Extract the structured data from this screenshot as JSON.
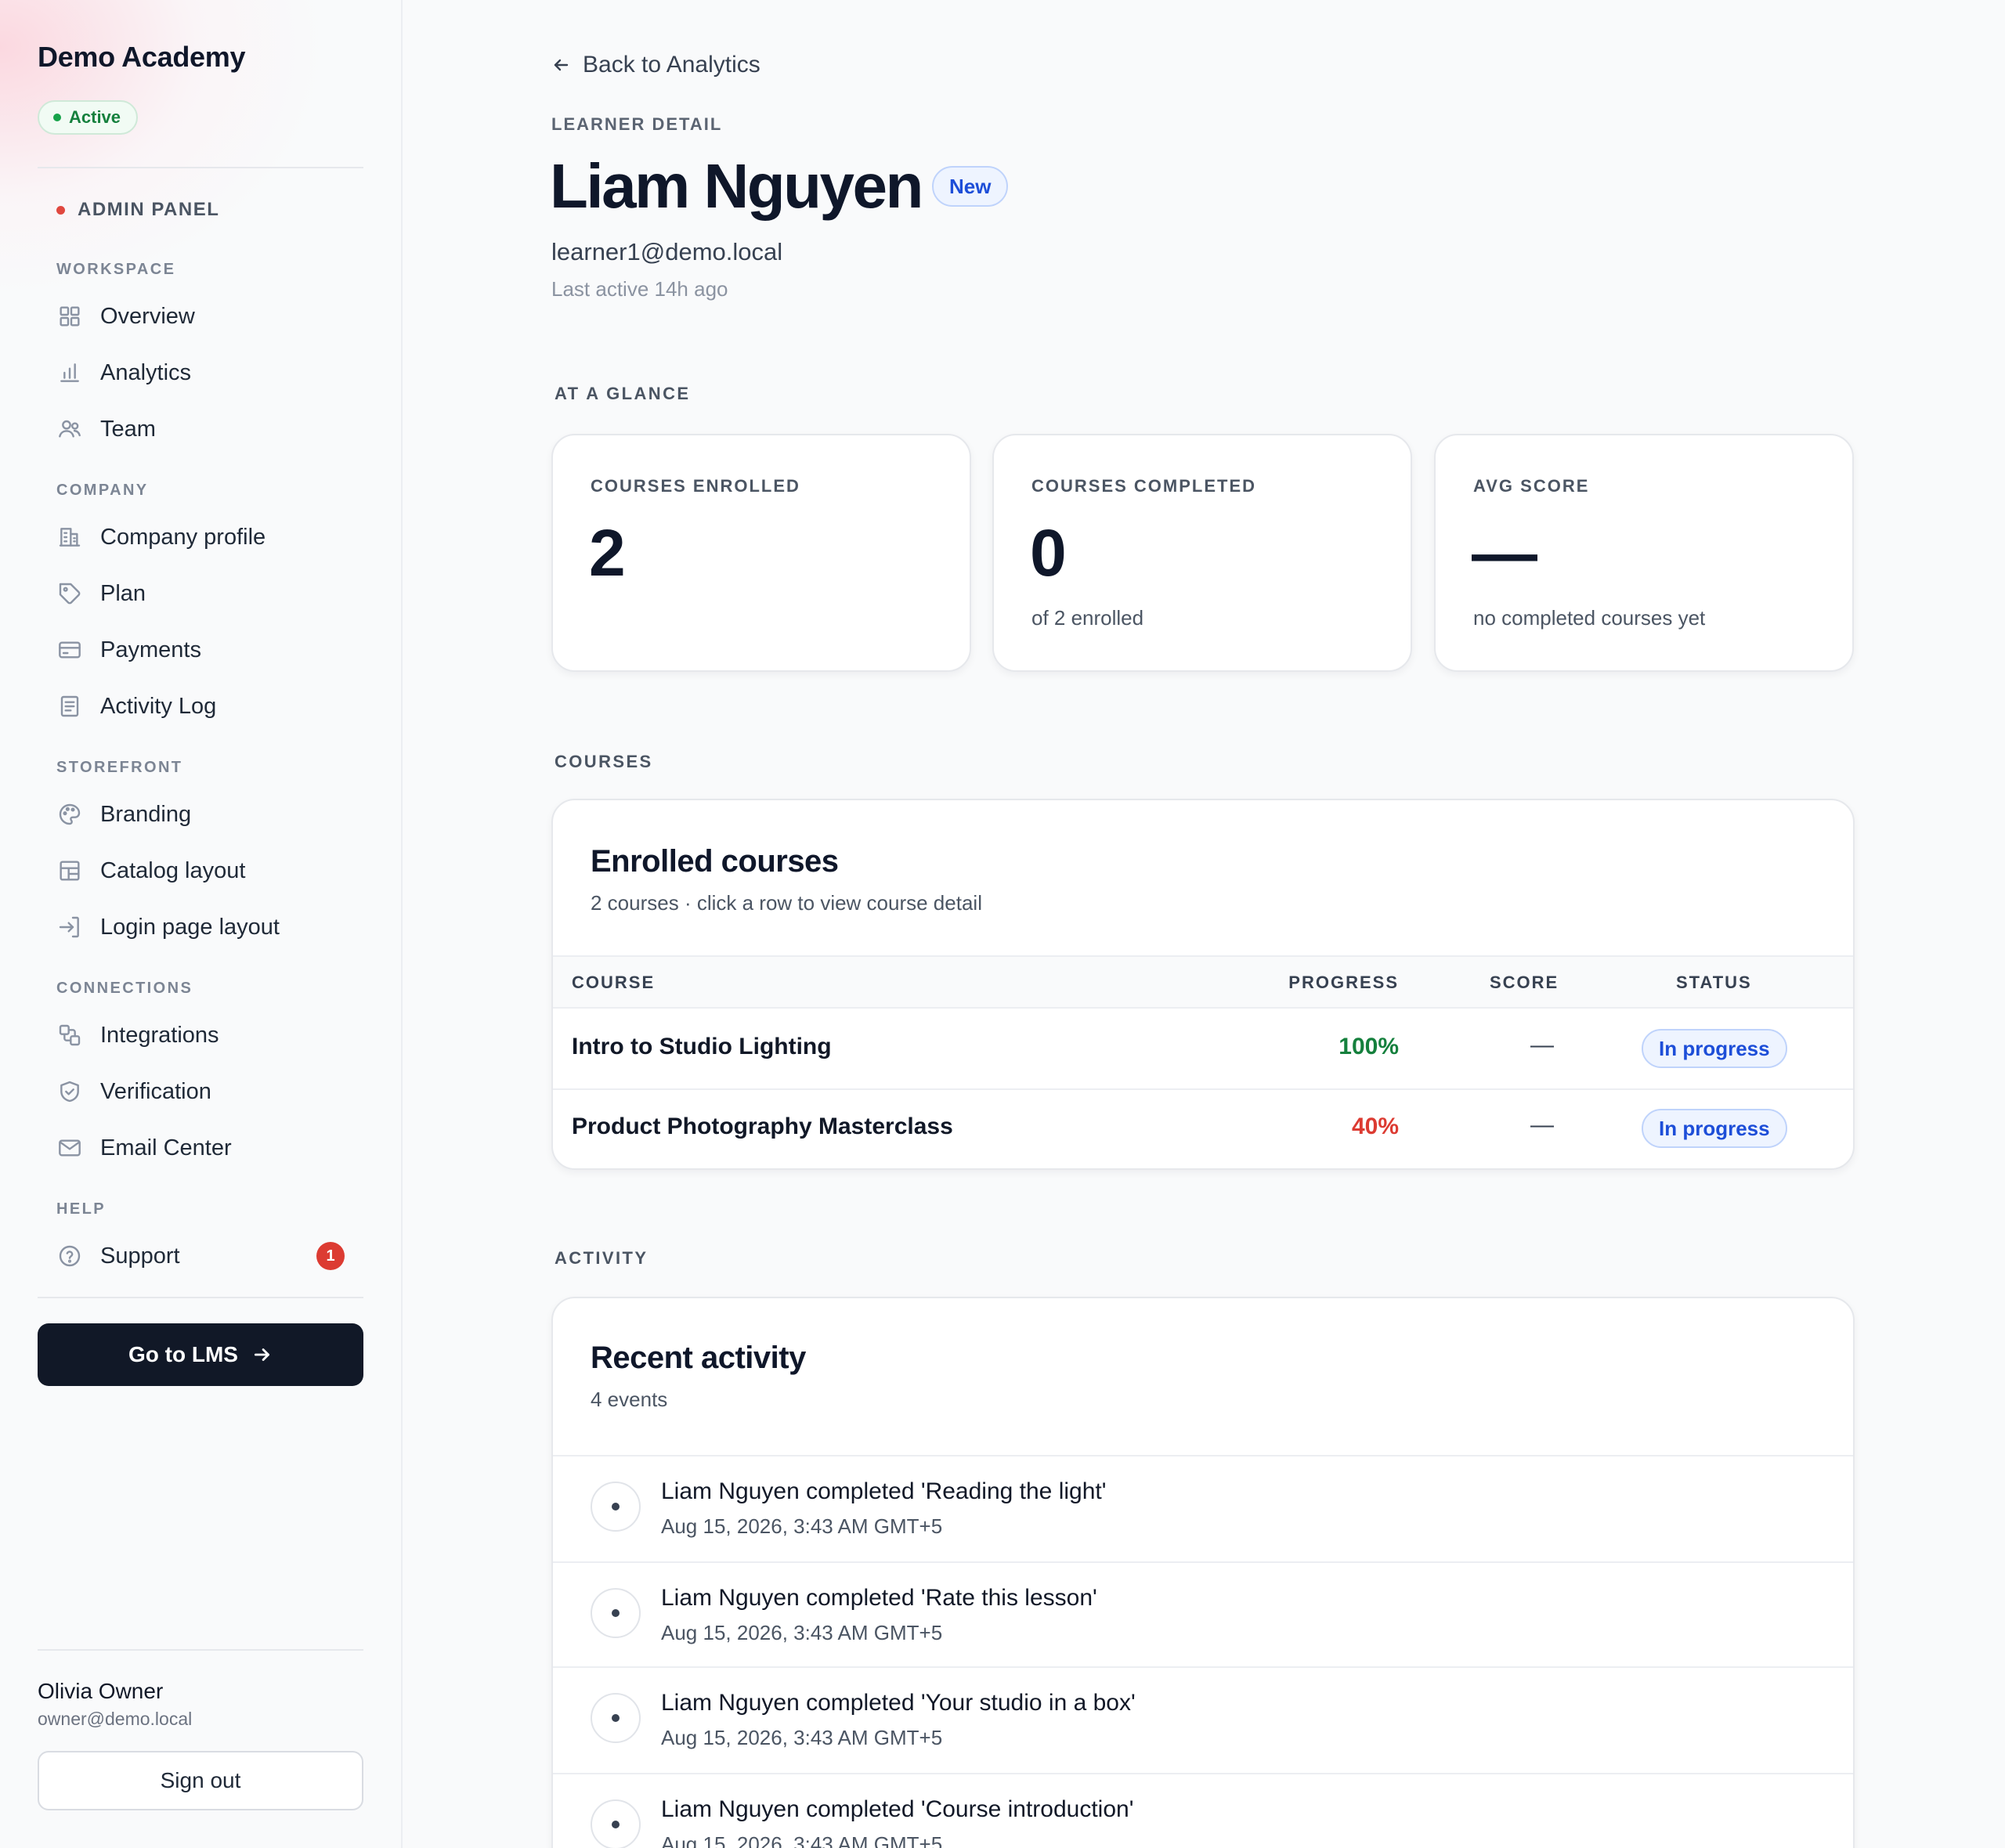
{
  "sidebar": {
    "brand": "Demo Academy",
    "status": "Active",
    "panel_label": "ADMIN PANEL",
    "sections": [
      {
        "label": "WORKSPACE",
        "items": [
          "Overview",
          "Analytics",
          "Team"
        ]
      },
      {
        "label": "COMPANY",
        "items": [
          "Company profile",
          "Plan",
          "Payments",
          "Activity Log"
        ]
      },
      {
        "label": "STOREFRONT",
        "items": [
          "Branding",
          "Catalog layout",
          "Login page layout"
        ]
      },
      {
        "label": "CONNECTIONS",
        "items": [
          "Integrations",
          "Verification",
          "Email Center"
        ]
      },
      {
        "label": "HELP",
        "items": [
          "Support"
        ]
      }
    ],
    "support_badge": "1",
    "go_lms": "Go to LMS",
    "user": {
      "name": "Olivia Owner",
      "email": "owner@demo.local"
    },
    "sign_out": "Sign out"
  },
  "icons": {
    "overview": "grid-icon",
    "analytics": "bar-chart-icon",
    "team": "users-icon",
    "company_profile": "building-icon",
    "plan": "tag-icon",
    "payments": "credit-card-icon",
    "activity_log": "document-icon",
    "branding": "palette-icon",
    "catalog_layout": "layout-icon",
    "login_page_layout": "login-icon",
    "integrations": "integrations-icon",
    "verification": "shield-check-icon",
    "email_center": "mail-icon",
    "support": "help-circle-icon"
  },
  "header": {
    "back_link": "Back to Analytics",
    "eyebrow": "LEARNER DETAIL",
    "name": "Liam Nguyen",
    "badge": "New",
    "email": "learner1@demo.local",
    "last_active": "Last active 14h ago"
  },
  "glance": {
    "heading": "AT A GLANCE",
    "cards": [
      {
        "label": "COURSES ENROLLED",
        "value": "2",
        "sub": ""
      },
      {
        "label": "COURSES COMPLETED",
        "value": "0",
        "sub": "of 2 enrolled"
      },
      {
        "label": "AVG SCORE",
        "value": "—",
        "sub": "no completed courses yet"
      }
    ]
  },
  "courses": {
    "heading": "COURSES",
    "title": "Enrolled courses",
    "subtitle": "2 courses · click a row to view course detail",
    "columns": {
      "course": "COURSE",
      "progress": "PROGRESS",
      "score": "SCORE",
      "status": "STATUS"
    },
    "rows": [
      {
        "course": "Intro to Studio Lighting",
        "progress": "100%",
        "score": "—",
        "status": "In progress"
      },
      {
        "course": "Product Photography Masterclass",
        "progress": "40%",
        "score": "—",
        "status": "In progress"
      }
    ]
  },
  "activity": {
    "heading": "ACTIVITY",
    "title": "Recent activity",
    "subtitle": "4 events",
    "events": [
      {
        "text": "Liam Nguyen completed 'Reading the light'",
        "time": "Aug 15, 2026, 3:43 AM GMT+5"
      },
      {
        "text": "Liam Nguyen completed 'Rate this lesson'",
        "time": "Aug 15, 2026, 3:43 AM GMT+5"
      },
      {
        "text": "Liam Nguyen completed 'Your studio in a box'",
        "time": "Aug 15, 2026, 3:43 AM GMT+5"
      },
      {
        "text": "Liam Nguyen completed 'Course introduction'",
        "time": "Aug 15, 2026, 3:43 AM GMT+5"
      }
    ]
  },
  "colors": {
    "progress_complete": "#15803d",
    "progress_partial": "#dc3b32",
    "accent_blue": "#1d4ed8",
    "active_green": "#16a34a",
    "dark": "#111827"
  }
}
